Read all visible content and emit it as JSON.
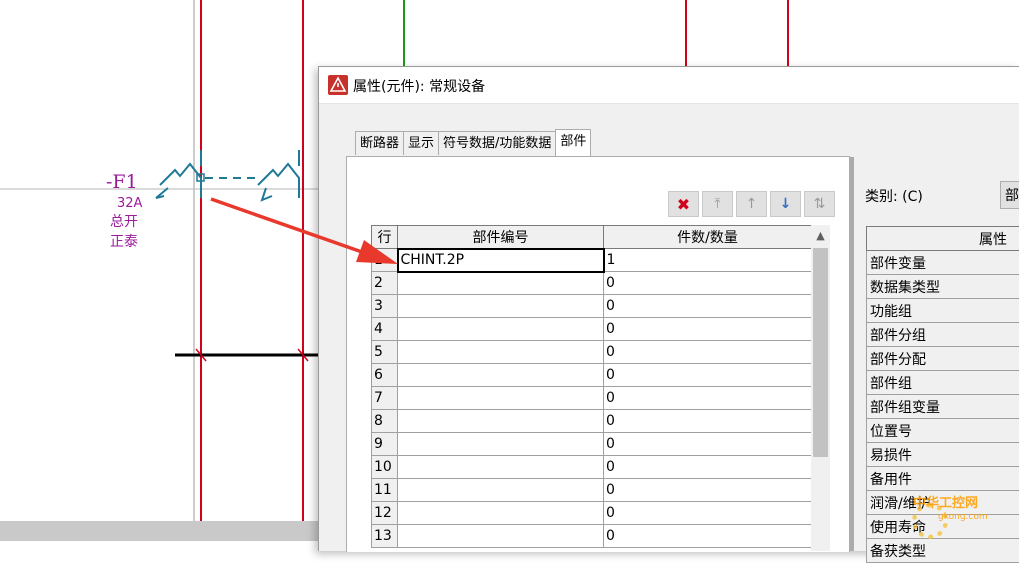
{
  "schematic": {
    "device_tag": "-F1",
    "rating": "32A",
    "function_text": "总开",
    "manufacturer_text": "正泰"
  },
  "dialog": {
    "title": "属性(元件): 常规设备",
    "tabs": [
      {
        "label": "断路器"
      },
      {
        "label": "显示"
      },
      {
        "label": "符号数据/功能数据"
      },
      {
        "label": "部件"
      }
    ],
    "toolbar": {
      "delete_icon": "delete-x-icon",
      "move_top_icon": "move-top-icon",
      "move_up_icon": "move-up-icon",
      "move_down_icon": "move-down-icon",
      "swap_icon": "swap-icon"
    },
    "parts_table": {
      "headers": {
        "row": "行",
        "part_number": "部件编号",
        "quantity": "件数/数量"
      },
      "rows": [
        {
          "n": "1",
          "part": "CHINT.2P",
          "qty": "1"
        },
        {
          "n": "2",
          "part": "",
          "qty": "0"
        },
        {
          "n": "3",
          "part": "",
          "qty": "0"
        },
        {
          "n": "4",
          "part": "",
          "qty": "0"
        },
        {
          "n": "5",
          "part": "",
          "qty": "0"
        },
        {
          "n": "6",
          "part": "",
          "qty": "0"
        },
        {
          "n": "7",
          "part": "",
          "qty": "0"
        },
        {
          "n": "8",
          "part": "",
          "qty": "0"
        },
        {
          "n": "9",
          "part": "",
          "qty": "0"
        },
        {
          "n": "10",
          "part": "",
          "qty": "0"
        },
        {
          "n": "11",
          "part": "",
          "qty": "0"
        },
        {
          "n": "12",
          "part": "",
          "qty": "0"
        },
        {
          "n": "13",
          "part": "",
          "qty": "0"
        }
      ]
    },
    "category": {
      "label": "类别: (C)",
      "value": "部"
    },
    "properties": {
      "header": "属性",
      "items": [
        "部件变量",
        "数据集类型",
        "功能组",
        "部件分组",
        "部件分配",
        "部件组",
        "部件组变量",
        "位置号",
        "易损件",
        "备用件",
        "润滑/维护",
        "使用寿命",
        "备获类型"
      ]
    }
  },
  "watermark": {
    "text": "中华工控网",
    "url_text": "gkong.com"
  },
  "colors": {
    "wire_red": "#d0021b",
    "wire_green": "#1a9a1a",
    "symbol_teal": "#1f7a96",
    "text_purple": "#9b1b9b",
    "arrow_red": "#e8392c"
  }
}
